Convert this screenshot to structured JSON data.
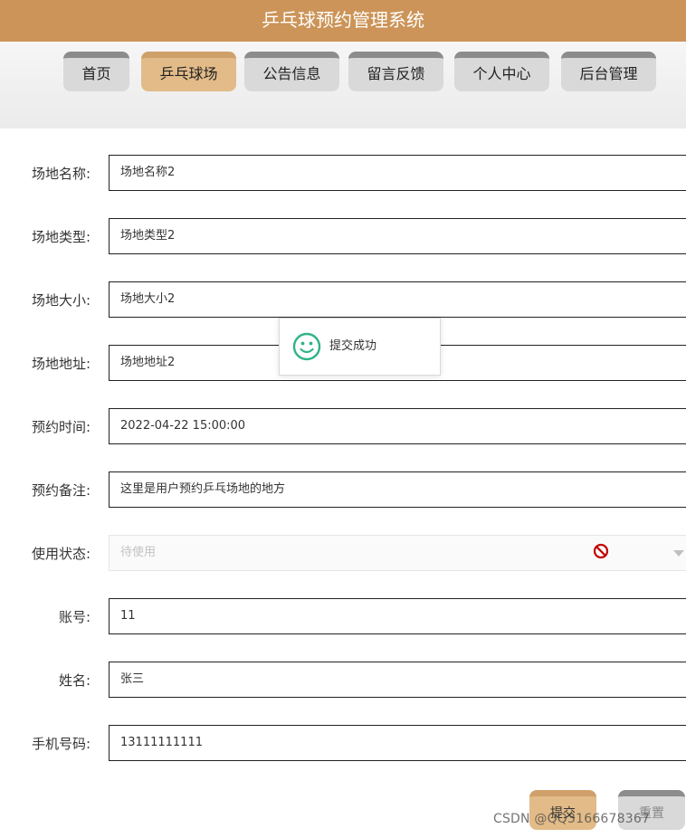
{
  "header": {
    "title": "乒乓球预约管理系统"
  },
  "nav": {
    "tabs": [
      {
        "label": "首页"
      },
      {
        "label": "乒乓球场",
        "active": true
      },
      {
        "label": "公告信息"
      },
      {
        "label": "留言反馈"
      },
      {
        "label": "个人中心"
      },
      {
        "label": "后台管理"
      }
    ]
  },
  "form": {
    "fields": [
      {
        "label": "场地名称:",
        "value": "场地名称2"
      },
      {
        "label": "场地类型:",
        "value": "场地类型2"
      },
      {
        "label": "场地大小:",
        "value": "场地大小2"
      },
      {
        "label": "场地地址:",
        "value": "场地地址2"
      },
      {
        "label": "预约时间:",
        "value": "2022-04-22 15:00:00"
      },
      {
        "label": "预约备注:",
        "value": "这里是用户预约乒乓场地的地方"
      },
      {
        "label": "使用状态:",
        "value": "待使用",
        "disabled": true
      },
      {
        "label": "账号:",
        "value": "11"
      },
      {
        "label": "姓名:",
        "value": "张三"
      },
      {
        "label": "手机号码:",
        "value": "13111111111"
      }
    ],
    "submit_label": "提交",
    "reset_label": "重置"
  },
  "toast": {
    "text": "提交成功",
    "icon": "smile-icon"
  },
  "watermark": "CSDN @QQ3166678367",
  "colors": {
    "header_bg": "#cc9458",
    "tab_active_bg": "#e2bb88",
    "tab_bg": "#d9d9d9",
    "success": "#2fb389",
    "disabled_icon": "#c40000"
  }
}
